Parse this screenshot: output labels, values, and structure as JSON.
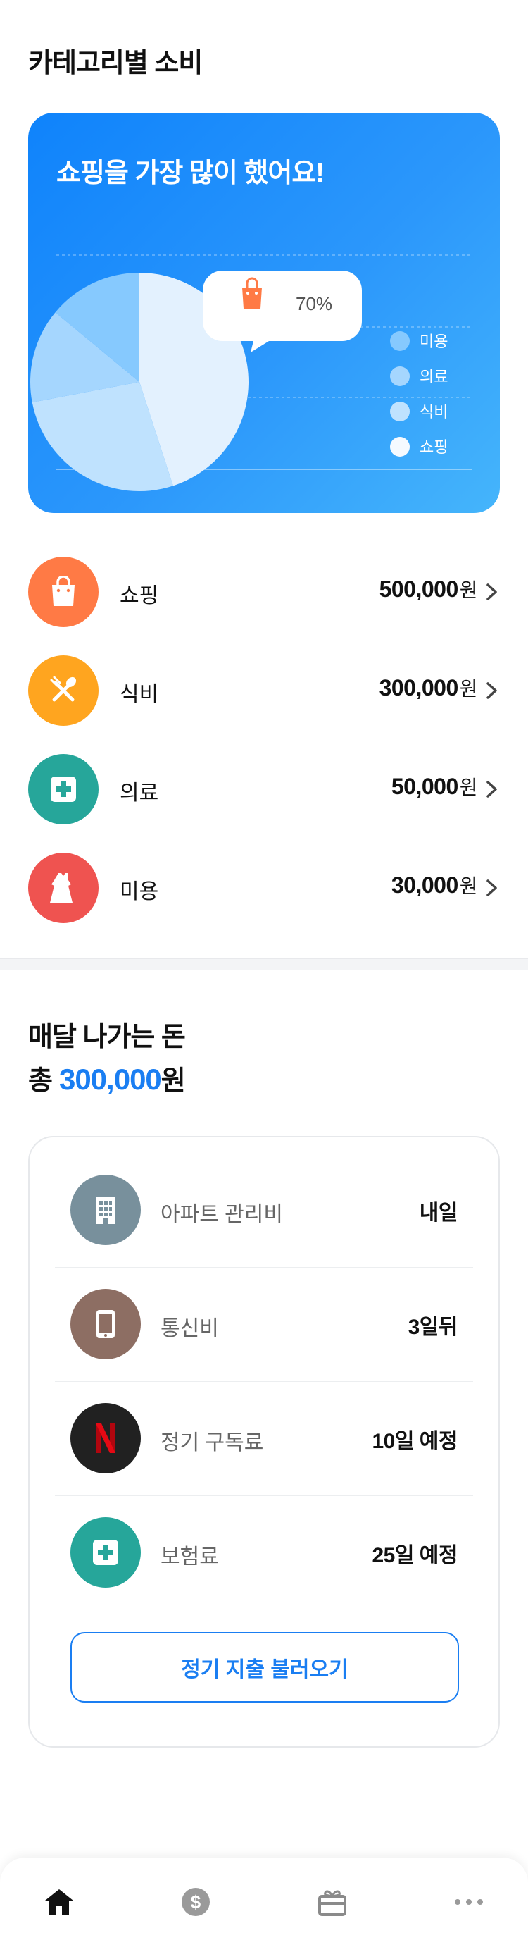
{
  "category_section": {
    "title": "카테고리별 소비",
    "card_title": "쇼핑을 가장 많이 했어요!",
    "tooltip_percent": "70%",
    "colors": {
      "card_start": "#0f83fb",
      "card_end": "#45b5fb"
    }
  },
  "chart_data": {
    "type": "pie",
    "categories": [
      "쇼핑",
      "식비",
      "의료",
      "미용"
    ],
    "values": [
      45,
      27,
      14,
      14
    ],
    "legend": [
      "미용",
      "의료",
      "식비",
      "쇼핑"
    ],
    "legend_position": "right",
    "colors": {
      "쇼핑": "#e3f1fe",
      "식비": "#bfe2fe",
      "의료": "#a5d6fe",
      "미용": "#86c9fe"
    }
  },
  "categories": [
    {
      "label": "쇼핑",
      "amount": "500,000",
      "unit": "원",
      "icon": "shopping-bag-icon",
      "color": "#ff7a45"
    },
    {
      "label": "식비",
      "amount": "300,000",
      "unit": "원",
      "icon": "utensils-icon",
      "color": "#ffa51f"
    },
    {
      "label": "의료",
      "amount": "50,000",
      "unit": "원",
      "icon": "medical-cross-icon",
      "color": "#26a69a"
    },
    {
      "label": "미용",
      "amount": "30,000",
      "unit": "원",
      "icon": "dress-icon",
      "color": "#ef5350"
    }
  ],
  "monthly": {
    "title": "매달 나가는 돈",
    "total_prefix": "총",
    "total_amount": "300,000",
    "total_unit": "원",
    "bills": [
      {
        "label": "아파트 관리비",
        "due": "내일",
        "icon": "building-icon",
        "color": "#78909c"
      },
      {
        "label": "통신비",
        "due": "3일뒤",
        "icon": "phone-icon",
        "color": "#8d6e63"
      },
      {
        "label": "정기 구독료",
        "due": "10일 예정",
        "icon": "netflix-icon",
        "color": "#212121"
      },
      {
        "label": "보험료",
        "due": "25일 예정",
        "icon": "medical-cross-icon",
        "color": "#26a69a"
      }
    ],
    "load_button": "정기 지출 불러오기",
    "accent": "#1a7ef2"
  },
  "bottom_nav": {
    "items": [
      "home-icon",
      "dollar-icon",
      "gift-icon",
      "more-icon"
    ]
  }
}
